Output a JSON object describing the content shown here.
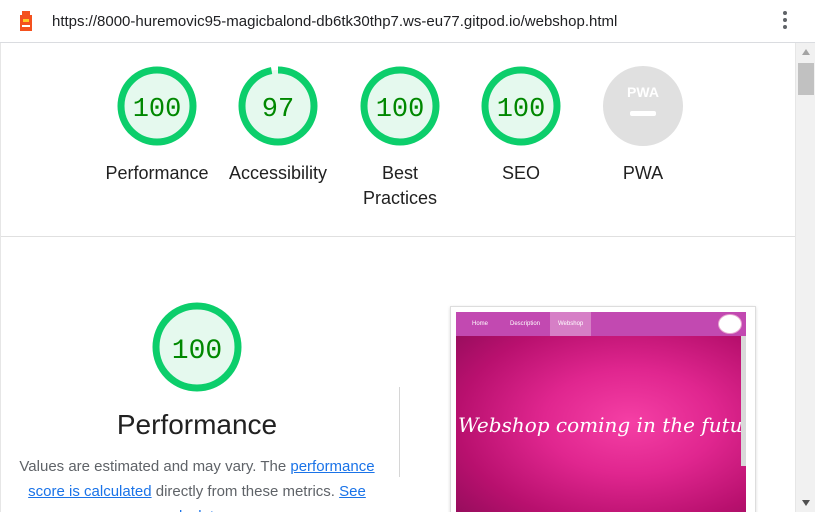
{
  "url_bar": {
    "url": "https://8000-huremovic95-magicbalond-db6tk30thp7.ws-eu77.gitpod.io/webshop.html",
    "icon": "lighthouse-icon",
    "menu_icon": "kebab-menu-icon"
  },
  "gauges": [
    {
      "label": "Performance",
      "score": "100",
      "fraction": 1.0
    },
    {
      "label": "Accessibility",
      "score": "97",
      "fraction": 0.97
    },
    {
      "label": "Best Practices",
      "label_line1": "Best",
      "label_line2": "Practices",
      "score": "100",
      "fraction": 1.0
    },
    {
      "label": "SEO",
      "score": "100",
      "fraction": 1.0
    },
    {
      "label": "PWA",
      "badge": "PWA"
    }
  ],
  "performance": {
    "score": "100",
    "fraction": 1.0,
    "title": "Performance",
    "desc_prefix": "Values are estimated and may vary. The ",
    "desc_link1": "performance score is calculated",
    "desc_middle": " directly from these metrics. ",
    "desc_link2": "See calculator."
  },
  "screenshot": {
    "nav": [
      "Home",
      "Description",
      "Webshop"
    ],
    "hero_text": "Webshop coming in the future"
  },
  "colors": {
    "pass": "#0cce6b",
    "pass_bg": "#e5f9ee",
    "pass_text": "#008800",
    "pwa_grey": "#e0e0e0",
    "nav_pink": "#c249b1"
  }
}
